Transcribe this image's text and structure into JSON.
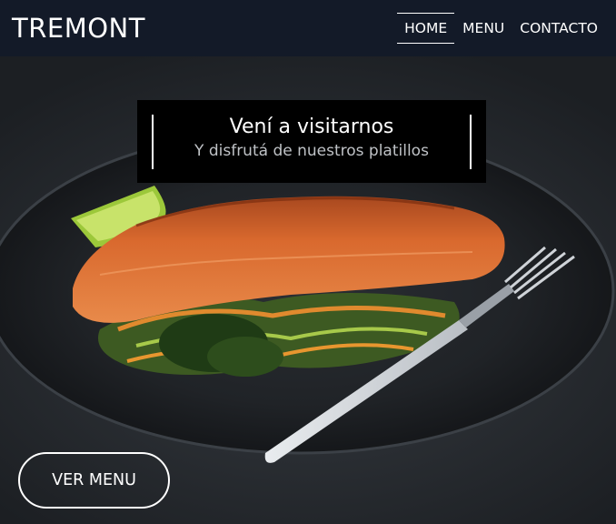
{
  "header": {
    "brand": "TREMONT",
    "nav": [
      {
        "label": "HOME",
        "active": true
      },
      {
        "label": "MENU",
        "active": false
      },
      {
        "label": "CONTACTO",
        "active": false
      }
    ]
  },
  "hero": {
    "title": "Vení a visitarnos",
    "subtitle": "Y disfrutá de nuestros platillos",
    "cta_label": "VER MENU"
  },
  "colors": {
    "header_bg": "#131a28",
    "caption_bg": "#000000",
    "text": "#ffffff"
  }
}
